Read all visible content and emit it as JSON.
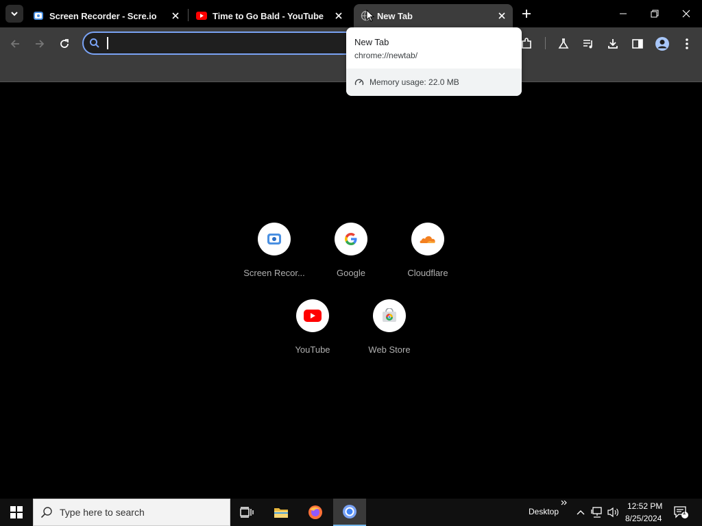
{
  "tabs": [
    {
      "title": "Screen Recorder - Scre.io",
      "favicon": "screen-recorder-favicon"
    },
    {
      "title": "Time to Go Bald - YouTube",
      "favicon": "youtube-favicon"
    },
    {
      "title": "New Tab",
      "favicon": "globe-favicon",
      "active": true
    }
  ],
  "omnibox": {
    "value": "",
    "placeholder": ""
  },
  "hovercard": {
    "title": "New Tab",
    "url": "chrome://newtab/",
    "memory": "Memory usage: 22.0 MB"
  },
  "shortcuts": [
    {
      "label": "Screen Recor...",
      "icon": "screen-recorder-icon"
    },
    {
      "label": "Google",
      "icon": "google-icon"
    },
    {
      "label": "Cloudflare",
      "icon": "cloudflare-icon"
    },
    {
      "label": "YouTube",
      "icon": "youtube-icon"
    },
    {
      "label": "Web Store",
      "icon": "web-store-icon"
    }
  ],
  "taskbar": {
    "search_placeholder": "Type here to search",
    "desktop_label": "Desktop",
    "time": "12:52 PM",
    "date": "8/25/2024",
    "notification_count": "1"
  },
  "colors": {
    "accent": "#7aa3f5",
    "youtube_red": "#ff0000",
    "toolbar_bg": "#3c3c3c",
    "page_bg": "#000000"
  }
}
